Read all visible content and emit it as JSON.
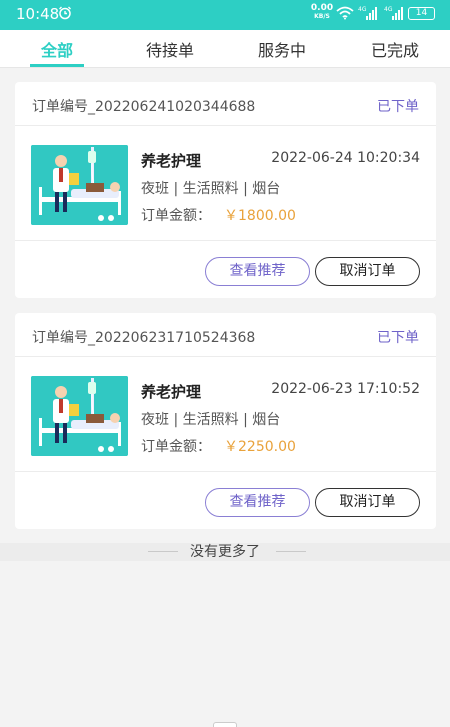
{
  "status_bar": {
    "time": "10:48",
    "net_speed_value": "0.00",
    "net_speed_unit": "KB/S",
    "signal_label_1": "4G",
    "signal_label_2": "4G",
    "battery": "14"
  },
  "tabs": [
    {
      "label": "全部",
      "active": true
    },
    {
      "label": "待接单",
      "active": false
    },
    {
      "label": "服务中",
      "active": false
    },
    {
      "label": "已完成",
      "active": false
    }
  ],
  "orders": [
    {
      "order_no": "订单编号_202206241020344688",
      "status": "已下单",
      "service_name": "养老护理",
      "time": "2022-06-24 10:20:34",
      "tags": "夜班 | 生活照料 | 烟台",
      "amount_label": "订单金额：",
      "amount": "￥1800.00",
      "view_label": "查看推荐",
      "cancel_label": "取消订单"
    },
    {
      "order_no": "订单编号_202206231710524368",
      "status": "已下单",
      "service_name": "养老护理",
      "time": "2022-06-23 17:10:52",
      "tags": "夜班 | 生活照料 | 烟台",
      "amount_label": "订单金额：",
      "amount": "￥2250.00",
      "view_label": "查看推荐",
      "cancel_label": "取消订单"
    }
  ],
  "footer": {
    "no_more": "没有更多了"
  },
  "colors": {
    "accent": "#2dcfc4",
    "status": "#6f63c9",
    "amount": "#e9a23b"
  },
  "icons": [
    "alarm-icon",
    "wifi-icon",
    "signal-icon",
    "battery-icon",
    "caregiver-illustration"
  ]
}
